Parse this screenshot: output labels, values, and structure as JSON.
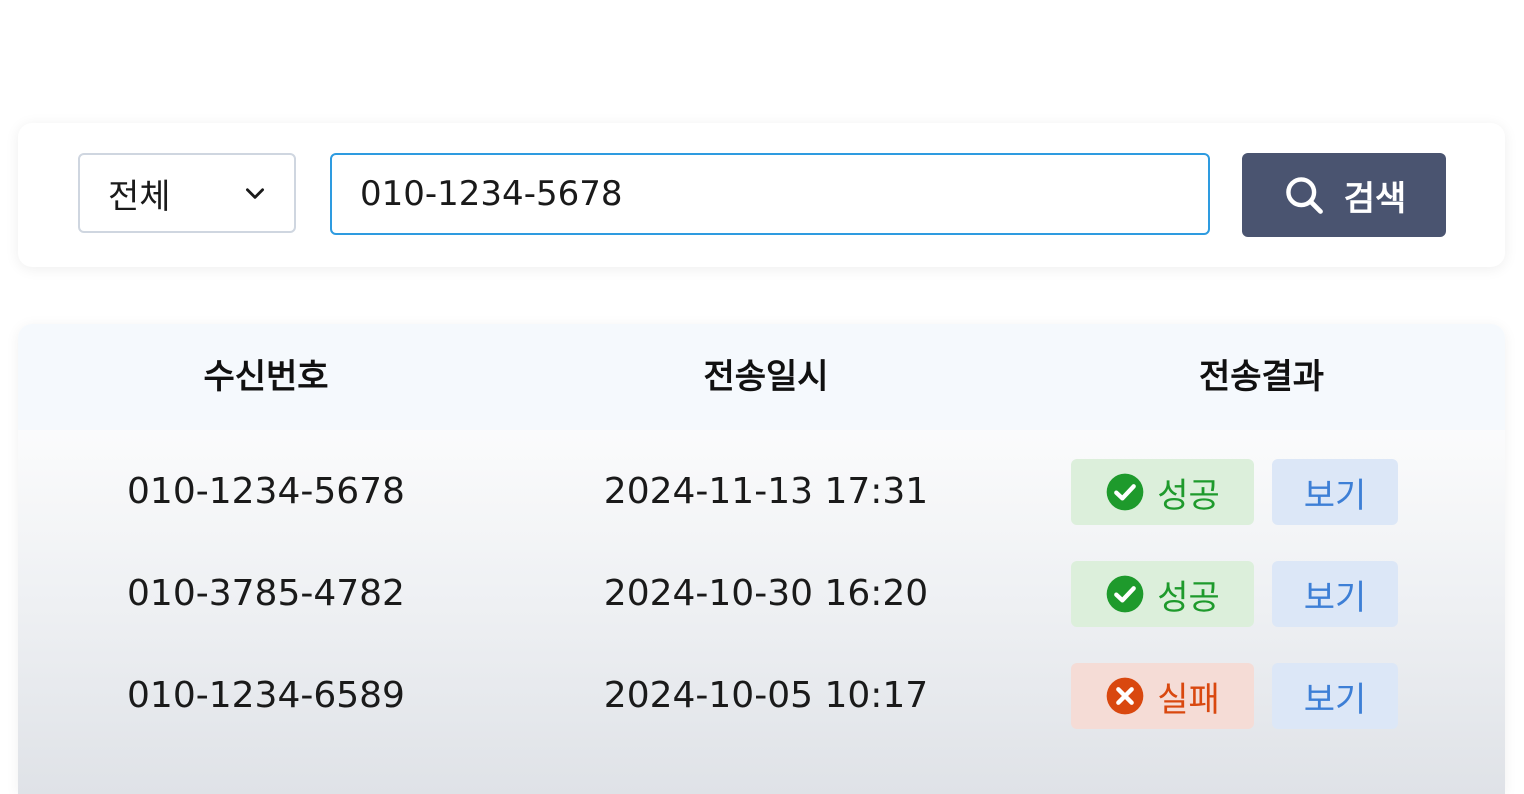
{
  "search": {
    "filter_selected": "전체",
    "query_value": "010-1234-5678",
    "button_label": "검색"
  },
  "table": {
    "headers": [
      "수신번호",
      "전송일시",
      "전송결과"
    ],
    "rows": [
      {
        "number": "010-1234-5678",
        "datetime": "2024-11-13 17:31",
        "status": "성공",
        "status_type": "success",
        "action": "보기"
      },
      {
        "number": "010-3785-4782",
        "datetime": "2024-10-30 16:20",
        "status": "성공",
        "status_type": "success",
        "action": "보기"
      },
      {
        "number": "010-1234-6589",
        "datetime": "2024-10-05 10:17",
        "status": "실패",
        "status_type": "fail",
        "action": "보기"
      }
    ]
  },
  "colors": {
    "accent_border": "#2e9be0",
    "search_button_bg": "#4a5470",
    "success": "#1e9a2c",
    "fail": "#d9480f",
    "view_button_text": "#3d7fd6"
  },
  "icons": {
    "filter": "chevron-down-icon",
    "search": "search-icon",
    "success": "check-circle-icon",
    "fail": "x-circle-icon"
  }
}
